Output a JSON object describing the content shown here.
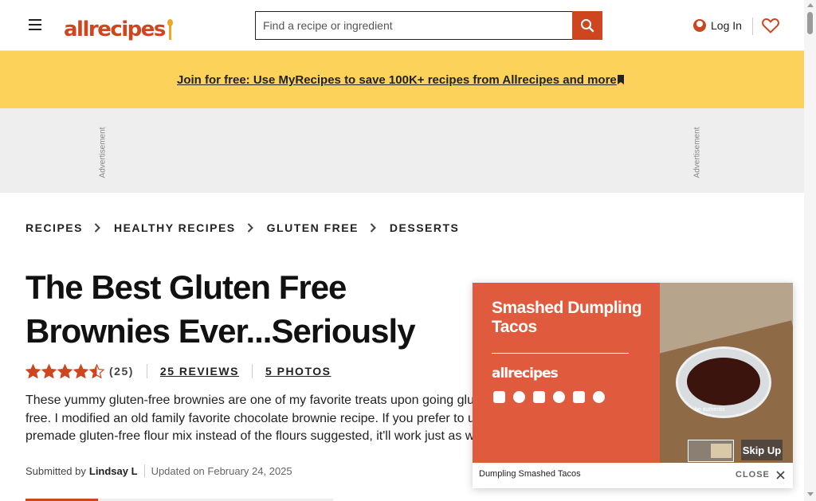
{
  "header": {
    "logo_text": "allrecipes",
    "search_placeholder": "Find a recipe or ingredient",
    "login_label": "Log In"
  },
  "banner": {
    "link_text": "Join for free: Use MyRecipes to save 100K+ recipes from Allrecipes and more"
  },
  "ad": {
    "label": "Advertisement"
  },
  "breadcrumbs": [
    {
      "label": "RECIPES"
    },
    {
      "label": "HEALTHY RECIPES"
    },
    {
      "label": "GLUTEN FREE"
    },
    {
      "label": "DESSERTS"
    }
  ],
  "recipe": {
    "title": "The Best Gluten Free Brownies Ever...Seriously",
    "rating_value": 4.5,
    "rating_count": "(25)",
    "reviews_label": "25 REVIEWS",
    "photos_label": "5 PHOTOS",
    "description": "These yummy gluten-free brownies are one of my favorite treats upon going gluten-free. I modified an old family favorite chocolate brownie recipe. If you prefer to use a premade gluten-free flour mix instead of the flours suggested, it'll work just as well.",
    "submitted_by_label": "Submitted by",
    "author": "Lindsay L",
    "updated": "Updated on February 24, 2025"
  },
  "video_ad": {
    "title": "Smashed Dumpling Tacos",
    "logo_text": "allrecipes",
    "photo_caption": "be authentic",
    "skip_label": "Skip Up",
    "caption": "Dumpling Smashed Tacos",
    "close_label": "CLOSE",
    "social_icons": [
      "youtube-icon",
      "tiktok-icon",
      "instagram-icon",
      "facebook-icon",
      "x-icon",
      "pinterest-icon"
    ]
  },
  "colors": {
    "brand": "#ce4620",
    "banner": "#fcd25b",
    "ad_bg": "#eeeeee",
    "video_bg": "#e05a3e"
  }
}
